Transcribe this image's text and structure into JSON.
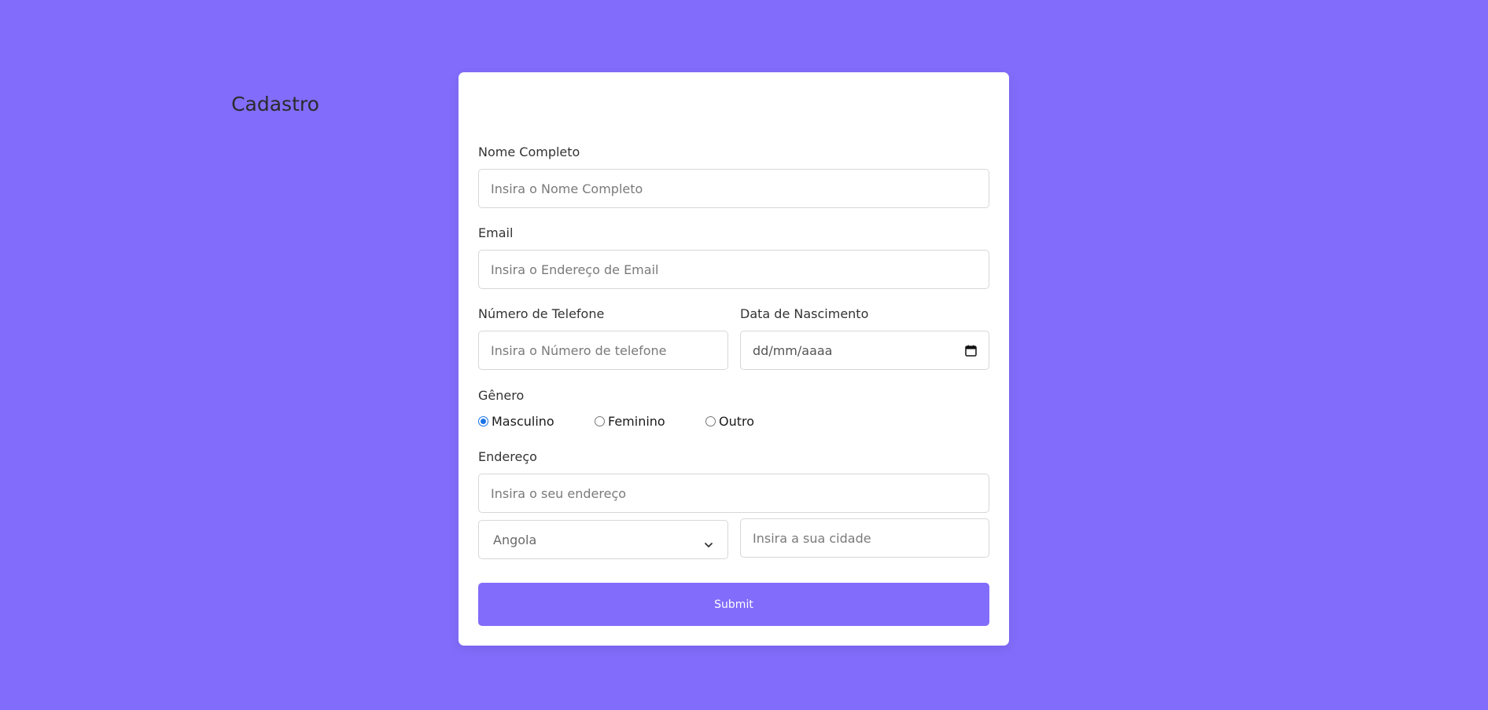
{
  "form": {
    "title": "Cadastro",
    "full_name": {
      "label": "Nome Completo",
      "placeholder": "Insira o Nome Completo"
    },
    "email": {
      "label": "Email",
      "placeholder": "Insira o Endereço de Email"
    },
    "phone": {
      "label": "Número de Telefone",
      "placeholder": "Insira o Número de telefone"
    },
    "birth_date": {
      "label": "Data de Nascimento",
      "placeholder": "dd/mm/aaaa",
      "icon": "calendar-icon"
    },
    "gender": {
      "label": "Gênero",
      "options": [
        {
          "label": "Masculino",
          "checked": true
        },
        {
          "label": "Feminino",
          "checked": false
        },
        {
          "label": "Outro",
          "checked": false
        }
      ]
    },
    "address": {
      "label": "Endereço",
      "placeholder": "Insira o seu endereço",
      "country_selected": "Angola",
      "country_icon": "chevron-down-icon",
      "city_placeholder": "Insira a sua cidade"
    },
    "submit_label": "Submit"
  },
  "colors": {
    "background": "#826cfb",
    "card": "#ffffff",
    "accent": "#826cfb",
    "radio_checked": "#1a73e8"
  }
}
